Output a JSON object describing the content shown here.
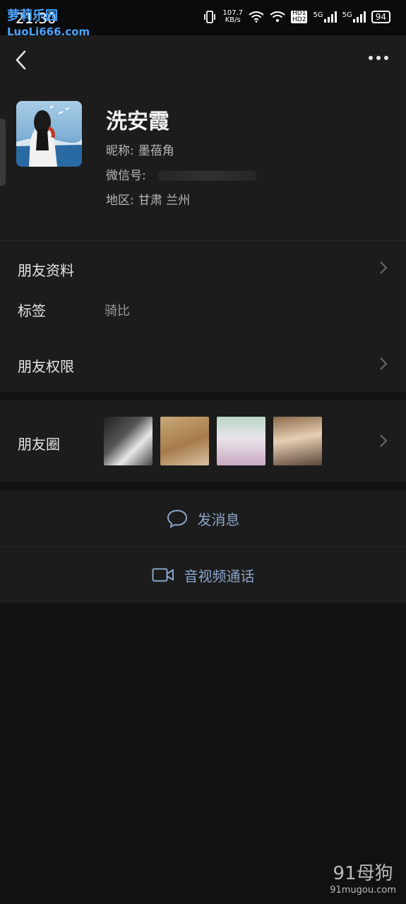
{
  "status_bar": {
    "time": "21:30",
    "network_speed": "107.7",
    "network_unit": "KB/s",
    "hd1": "HD1",
    "hd2": "HD2",
    "sim1": "5G",
    "sim2": "5G",
    "battery": "94"
  },
  "watermark_top": {
    "line1": "萝莉乐园",
    "line2": "LuoLi666.com"
  },
  "profile": {
    "name": "洗安霞",
    "nickname_label": "昵称:",
    "nickname": "墨蓓角",
    "wechat_id_label": "微信号:",
    "wechat_id": "",
    "region_label": "地区:",
    "region": "甘肃  兰州"
  },
  "rows": {
    "friend_info": "朋友资料",
    "tags_label": "标签",
    "tags_value": "骑比",
    "permissions": "朋友权限",
    "moments": "朋友圈"
  },
  "actions": {
    "message": "发消息",
    "call": "音视频通话"
  },
  "watermark_bottom": {
    "line1": "91母狗",
    "line2": "91mugou.com"
  },
  "colors": {
    "background": "#111111",
    "panel": "#1c1c1c",
    "action_text": "#8aa4c9"
  }
}
